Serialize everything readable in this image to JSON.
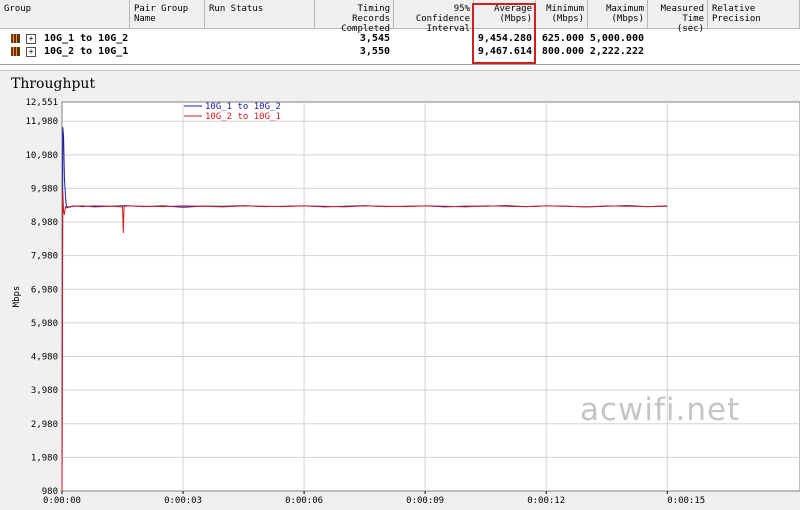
{
  "table": {
    "headers": [
      {
        "id": "group",
        "label": "Group"
      },
      {
        "id": "pair-group-name",
        "label": "Pair Group\nName"
      },
      {
        "id": "run-status",
        "label": "Run Status"
      },
      {
        "id": "timing-records",
        "label": "Timing Records\nCompleted"
      },
      {
        "id": "confidence",
        "label": "95% Confidence\nInterval"
      },
      {
        "id": "average",
        "label": "Average\n(Mbps)"
      },
      {
        "id": "minimum",
        "label": "Minimum\n(Mbps)"
      },
      {
        "id": "maximum",
        "label": "Maximum\n(Mbps)"
      },
      {
        "id": "measured-time",
        "label": "Measured\nTime (sec)"
      },
      {
        "id": "relative-precision",
        "label": "Relative\nPrecision"
      }
    ],
    "rows": [
      {
        "group": "10G_1 to 10G_2",
        "timing_records": "3,545",
        "average": "9,454.280",
        "minimum": "625.000",
        "maximum": "5,000.000"
      },
      {
        "group": "10G_2 to 10G_1",
        "timing_records": "3,550",
        "average": "9,467.614",
        "minimum": "800.000",
        "maximum": "2,222.222"
      }
    ]
  },
  "watermark": "acwifi.net",
  "colors": {
    "series1": "#1c1ca8",
    "series2": "#d61c1c",
    "highlight": "#d21e1e",
    "grid": "#d4d4d4"
  },
  "chart_data": {
    "type": "line",
    "title": "Throughput",
    "xlabel": "",
    "ylabel": "Mbps",
    "ylim": [
      980,
      12551
    ],
    "y_ticks": [
      980,
      1980,
      2980,
      3980,
      4980,
      5980,
      6980,
      7980,
      8980,
      9980,
      10980,
      11980,
      12551
    ],
    "y_tick_labels": [
      "980",
      "1,980",
      "2,980",
      "3,980",
      "4,980",
      "5,980",
      "6,980",
      "7,980",
      "8,980",
      "9,980",
      "10,980",
      "11,980",
      "12,551"
    ],
    "x_range_seconds": [
      0,
      15
    ],
    "x_ticks_seconds": [
      0,
      3,
      6,
      9,
      12,
      15
    ],
    "x_tick_labels": [
      "0:00:00",
      "0:00:03",
      "0:00:06",
      "0:00:09",
      "0:00:12",
      "0:00:15"
    ],
    "grid": true,
    "legend": "top-center",
    "series": [
      {
        "name": "10G_1 to 10G_2",
        "x": [
          0.0,
          0.02,
          0.04,
          0.06,
          0.08,
          0.1,
          0.12,
          0.15,
          0.3,
          0.5,
          0.8,
          1.2,
          1.6,
          2.0,
          2.5,
          3.0,
          3.5,
          4.0,
          4.5,
          5.0,
          5.5,
          6.0,
          6.5,
          7.0,
          7.5,
          8.0,
          8.5,
          9.0,
          9.5,
          10.0,
          10.5,
          11.0,
          11.5,
          12.0,
          12.5,
          13.0,
          13.5,
          14.0,
          14.5,
          15.0
        ],
        "values": [
          980,
          11800,
          11500,
          10300,
          9900,
          9550,
          9400,
          9420,
          9450,
          9460,
          9430,
          9450,
          9470,
          9440,
          9460,
          9420,
          9455,
          9450,
          9470,
          9440,
          9450,
          9460,
          9430,
          9450,
          9470,
          9440,
          9450,
          9460,
          9430,
          9455,
          9450,
          9470,
          9440,
          9460,
          9450,
          9430,
          9450,
          9470,
          9440,
          9450
        ]
      },
      {
        "name": "10G_2 to 10G_1",
        "x": [
          0.0,
          0.02,
          0.04,
          0.06,
          0.08,
          0.1,
          0.15,
          0.3,
          0.5,
          0.8,
          1.2,
          1.5,
          1.52,
          1.54,
          1.6,
          2.0,
          2.5,
          3.0,
          3.5,
          4.0,
          4.5,
          5.0,
          5.5,
          6.0,
          6.5,
          7.0,
          7.5,
          8.0,
          8.5,
          9.0,
          9.5,
          10.0,
          10.5,
          11.0,
          11.5,
          12.0,
          12.5,
          13.0,
          13.5,
          14.0,
          14.5,
          15.0
        ],
        "values": [
          980,
          9900,
          9300,
          9200,
          9400,
          9450,
          9430,
          9460,
          9440,
          9460,
          9450,
          9430,
          8650,
          9440,
          9460,
          9450,
          9440,
          9460,
          9450,
          9430,
          9460,
          9450,
          9440,
          9460,
          9450,
          9430,
          9460,
          9450,
          9440,
          9460,
          9450,
          9430,
          9460,
          9450,
          9440,
          9460,
          9450,
          9430,
          9460,
          9450,
          9440,
          9460
        ]
      }
    ]
  }
}
